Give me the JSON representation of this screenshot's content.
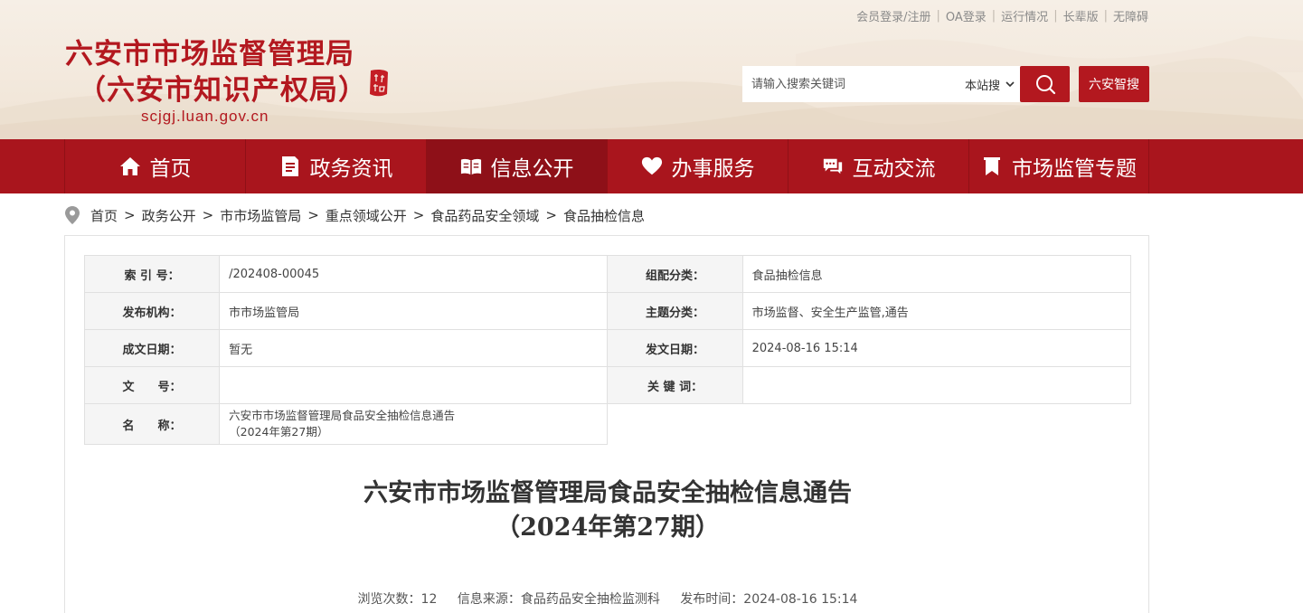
{
  "top_links": [
    "会员登录/注册",
    "OA登录",
    "运行情况",
    "长辈版",
    "无障碍"
  ],
  "logo": {
    "title_line1": "六安市市场监督管理局",
    "title_line2": "（六安市知识产权局）",
    "domain": "scjgj.luan.gov.cn"
  },
  "search": {
    "placeholder": "请输入搜索关键词",
    "scope": "本站搜",
    "smart_label": "六安智搜"
  },
  "nav": {
    "items": [
      {
        "label": "首页",
        "icon": "home-icon"
      },
      {
        "label": "政务资讯",
        "icon": "document-icon"
      },
      {
        "label": "信息公开",
        "icon": "book-icon"
      },
      {
        "label": "办事服务",
        "icon": "heart-icon"
      },
      {
        "label": "互动交流",
        "icon": "chat-icon"
      },
      {
        "label": "市场监管专题",
        "icon": "bookmark-icon"
      }
    ],
    "active_index": 2
  },
  "breadcrumb": [
    "首页",
    "政务公开",
    "市市场监管局",
    "重点领域公开",
    "食品药品安全领域",
    "食品抽检信息"
  ],
  "meta": {
    "index_no_label": "索 引 号：",
    "index_no": "/202408-00045",
    "category_label": "组配分类：",
    "category": "食品抽检信息",
    "publisher_label": "发布机构：",
    "publisher": "市市场监管局",
    "topic_label": "主题分类：",
    "topic": "市场监督、安全生产监管,通告",
    "created_label": "成文日期：",
    "created": "暂无",
    "issued_label": "发文日期：",
    "issued": "2024-08-16 15:14",
    "doc_no_label": "文　　号：",
    "doc_no": "",
    "keywords_label": "关 键 词：",
    "keywords": "",
    "name_label": "名　　称：",
    "name_line1": "六安市市场监督管理局食品安全抽检信息通告",
    "name_line2": "（2024年第27期）"
  },
  "article": {
    "title_line1": "六安市市场监督管理局食品安全抽检信息通告",
    "title_line2": "（2024年第27期）",
    "views": "浏览次数：12",
    "source": "信息来源：食品药品安全抽检监测科",
    "published": "发布时间：2024-08-16 15:14"
  },
  "colors": {
    "brand_red": "#b3181f",
    "nav_bg": "#a9151d",
    "nav_active": "#8e1018"
  }
}
